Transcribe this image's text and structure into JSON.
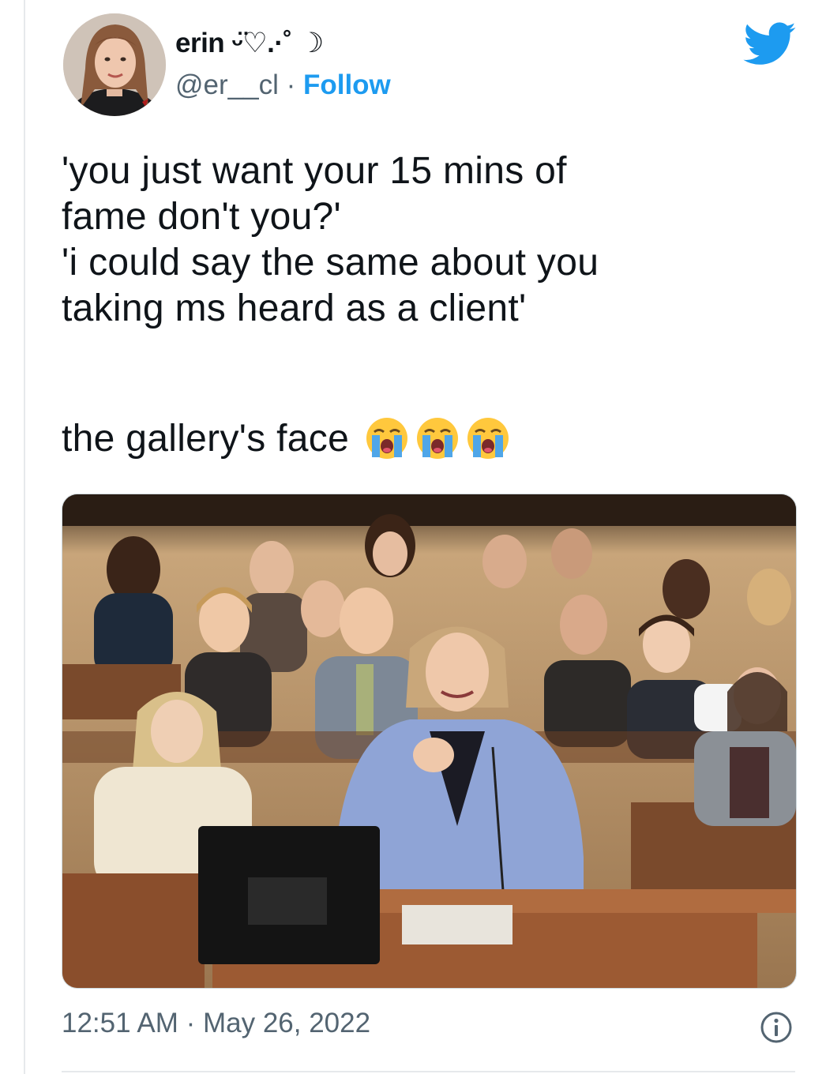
{
  "user": {
    "display_name": "erin ᵕ̈♡.·˚ ☽",
    "handle": "@er__cl",
    "separator": " · ",
    "follow_label": "Follow"
  },
  "tweet": {
    "text": "'you just want your 15 mins of\nfame don't you?'\n'i could say the same about you\ntaking ms heard as a client'",
    "caption": "the gallery's face",
    "emojis": [
      "loudly-crying-face",
      "loudly-crying-face",
      "loudly-crying-face"
    ]
  },
  "meta": {
    "timestamp": "12:51 AM · May 26, 2022"
  },
  "icons": {
    "brand": "twitter-bird-icon",
    "info": "info-icon"
  },
  "colors": {
    "link_blue": "#1d9bf0",
    "secondary_text": "#536471",
    "primary_text": "#0f1419",
    "divider": "#e6e9ec"
  }
}
